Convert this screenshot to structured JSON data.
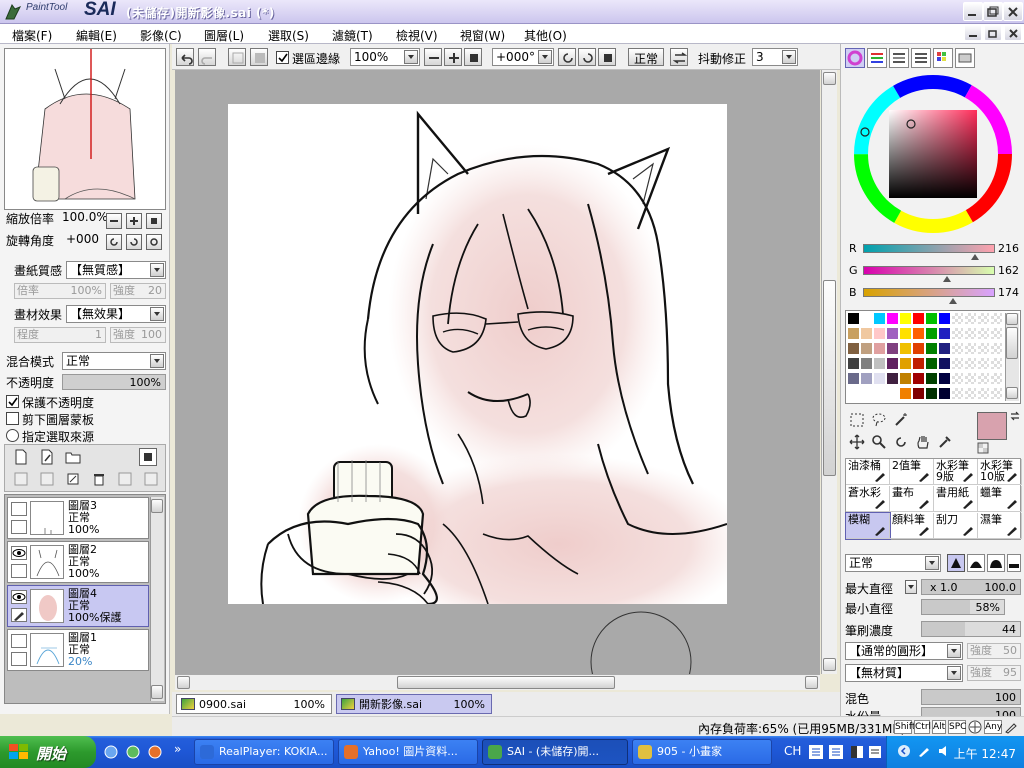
{
  "window": {
    "logo_text": "PaintTool",
    "logo_brand": "SAI",
    "title": "(未儲存)開新影像.sai (*)"
  },
  "menu": [
    "檔案(F)",
    "編輯(E)",
    "影像(C)",
    "圖層(L)",
    "選取(S)",
    "濾鏡(T)",
    "檢視(V)",
    "視窗(W)",
    "其他(O)"
  ],
  "navigator": {
    "zoom_label": "縮放倍率",
    "zoom_value": "100.0%",
    "rotate_label": "旋轉角度",
    "rotate_value": "+000"
  },
  "paper": {
    "texture_label": "畫紙質感",
    "texture_value": "【無質感】",
    "texture_rate_label": "倍率",
    "texture_rate_value": "100%",
    "texture_strength_label": "強度",
    "texture_strength_value": "20",
    "effect_label": "畫材效果",
    "effect_value": "【無效果】",
    "effect_degree_label": "程度",
    "effect_degree_value": "1",
    "effect_strength_label": "強度",
    "effect_strength_value": "100"
  },
  "layer_props": {
    "blend_label": "混合模式",
    "blend_value": "正常",
    "opacity_label": "不透明度",
    "opacity_value": "100%",
    "opacity_fraction": 1.0,
    "protect_opacity": "保護不透明度",
    "clip_mask": "剪下圖層蒙板",
    "selection_source": "指定選取來源"
  },
  "layers": [
    {
      "name": "圖層3",
      "mode": "正常",
      "opacity": "100%",
      "visible": false,
      "selected": false
    },
    {
      "name": "圖層2",
      "mode": "正常",
      "opacity": "100%",
      "visible": true,
      "selected": false
    },
    {
      "name": "圖層4",
      "mode": "正常",
      "opacity": "100%保護",
      "visible": true,
      "selected": true
    },
    {
      "name": "圖層1",
      "mode": "正常",
      "opacity": "20%",
      "visible": false,
      "selected": false
    }
  ],
  "toolbar": {
    "selection_edge": "選區邊緣",
    "zoom": "100%",
    "angle": "+000°",
    "blend": "正常",
    "stabilizer_label": "抖動修正",
    "stabilizer_value": "3"
  },
  "tabs": [
    {
      "name": "0900.sai",
      "zoom": "100%",
      "active": false
    },
    {
      "name": "開新影像.sai",
      "zoom": "100%",
      "active": true
    }
  ],
  "status": {
    "memory": "內存負荷率:65% (已用95MB/331MB)",
    "keys": [
      "Shift",
      "Ctrl",
      "Alt",
      "SPC",
      "Any"
    ]
  },
  "color": {
    "r_label": "R",
    "r_value": "216",
    "g_label": "G",
    "g_value": "162",
    "b_label": "B",
    "b_value": "174",
    "current_hex": "#d8a2ae"
  },
  "tools": [
    {
      "label": "油漆桶",
      "selected": false
    },
    {
      "label": "2值筆",
      "selected": false
    },
    {
      "label": "水彩筆9版",
      "selected": false
    },
    {
      "label": "水彩筆10版",
      "selected": false
    },
    {
      "label": "蒼水彩",
      "selected": false
    },
    {
      "label": "畫布",
      "selected": false
    },
    {
      "label": "書用紙",
      "selected": false
    },
    {
      "label": "蠟筆",
      "selected": false
    },
    {
      "label": "模糊",
      "selected": true
    },
    {
      "label": "顏料筆",
      "selected": false
    },
    {
      "label": "刮刀",
      "selected": false
    },
    {
      "label": "濕筆",
      "selected": false
    }
  ],
  "brush": {
    "mode": "正常",
    "max_size_label": "最大直徑",
    "max_size_mult": "x 1.0",
    "max_size_value": "100.0",
    "min_size_label": "最小直徑",
    "min_size_value": "58%",
    "min_size_fraction": 0.58,
    "density_label": "筆刷濃度",
    "density_value": "44",
    "density_fraction": 0.44,
    "shape": "【通常的圓形】",
    "shape_strength_label": "強度",
    "shape_strength_value": "50",
    "texture": "【無材質】",
    "texture_strength_label": "強度",
    "texture_strength_value": "95",
    "blend_label": "混色",
    "blend_value": "100",
    "water_label": "水份量",
    "water_value": "100"
  },
  "taskbar": {
    "start": "開始",
    "tasks": [
      {
        "label": "RealPlayer: KOKIA...",
        "color": "#2d6ad8"
      },
      {
        "label": "Yahoo! 圖片資料...",
        "color": "#e5702a"
      },
      {
        "label": "SAI - (未儲存)開...",
        "color": "#4aa64a",
        "active": true
      },
      {
        "label": "905 - 小畫家",
        "color": "#e0c040"
      }
    ],
    "lang": "CH",
    "clock": "上午 12:47"
  }
}
